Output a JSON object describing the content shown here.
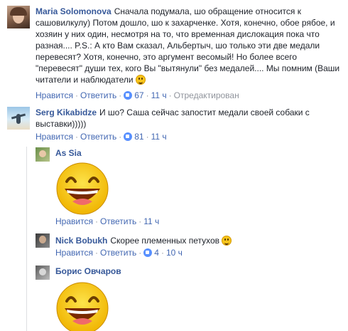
{
  "comments": [
    {
      "author": "Maria Solomonova",
      "text": "Сначала подумала, шо обращение относится к сашовилкулу) Потом дошло, шо к захарченке. Хотя, конечно, обое рябое, и хозяин у них один, несмотря на то, что временная дислокация пока что разная.... P.S.: А кто Вам сказал, Альбертыч, шо только эти две медали перевесят? Хотя, конечно, это аргумент весомый! Но более всего \"перевесят\" души тех, кого Вы \"вытянули\" без медалей.... Мы помним (Ваши читатели и наблюдатели",
      "like_label": "Нравится",
      "reply_label": "Ответить",
      "likes": "67",
      "time": "11 ч",
      "edited": "Отредактирован"
    },
    {
      "author": "Serg Kikabidze",
      "text": "И шо? Саша сейчас запостит медали своей собаки с выставки)))))",
      "like_label": "Нравится",
      "reply_label": "Ответить",
      "likes": "81",
      "time": "11 ч"
    }
  ],
  "replies": [
    {
      "author": "As Sia",
      "sticker": "laughing-smiley-sticker",
      "like_label": "Нравится",
      "reply_label": "Ответить",
      "time": "11 ч"
    },
    {
      "author": "Nick Bobukh",
      "text": "Скорее племенных петухов",
      "like_label": "Нравится",
      "reply_label": "Ответить",
      "likes": "4",
      "time": "10 ч"
    },
    {
      "author": "Борис Овчаров",
      "sticker": "laughing-smiley-sticker"
    }
  ],
  "colors": {
    "link": "#365899",
    "action": "#4267b2",
    "muted": "#90949c",
    "sticker_yellow": "#f7c51c"
  }
}
